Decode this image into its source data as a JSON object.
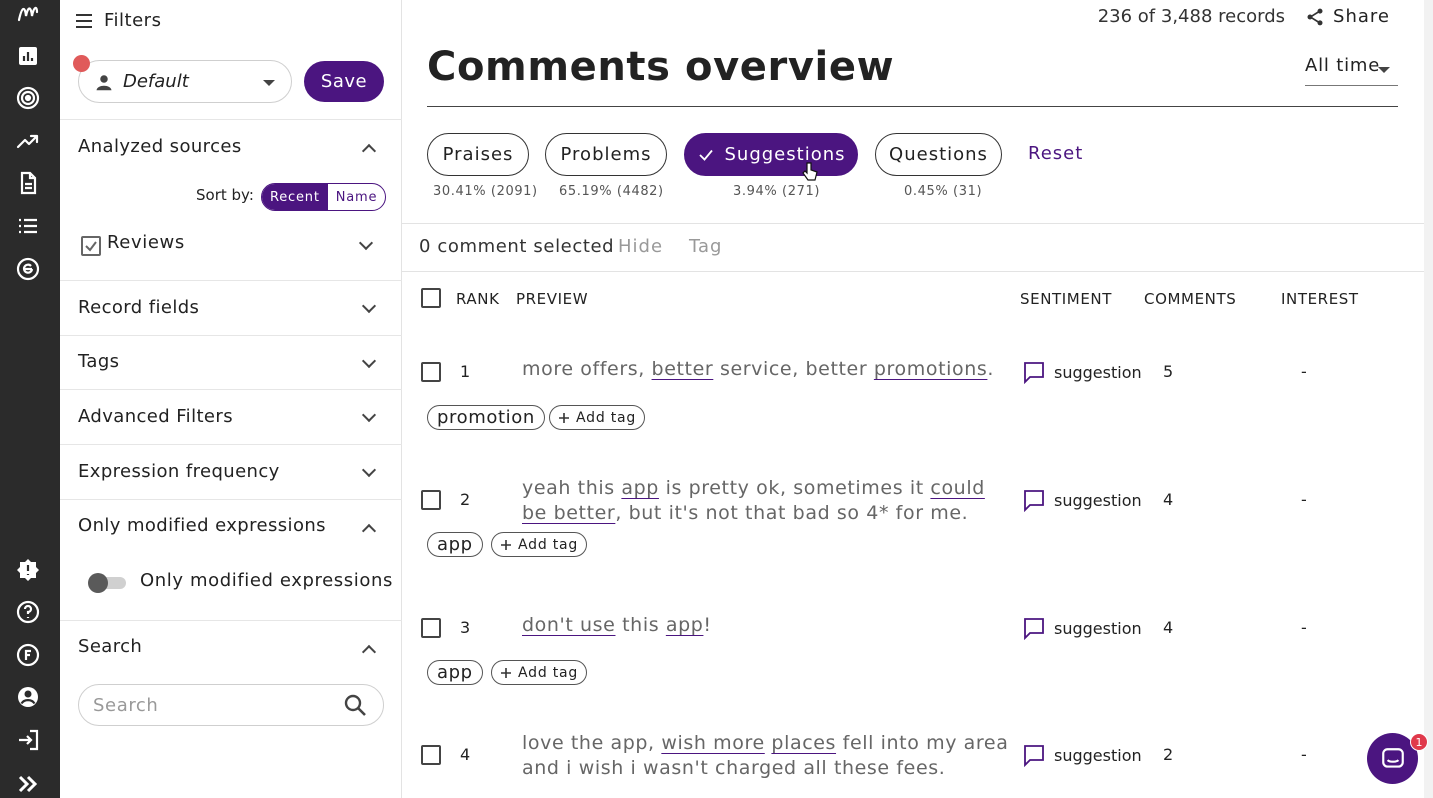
{
  "rail": {
    "icons": [
      "logo-icon",
      "dashboard-icon",
      "target-icon",
      "trend-icon",
      "document-icon",
      "list-icon",
      "explore-icon",
      "badge-icon",
      "help-icon",
      "forum-icon",
      "account-icon",
      "logout-icon",
      "expand-icon"
    ]
  },
  "filters": {
    "title": "Filters",
    "preset_value": "Default",
    "save_label": "Save",
    "sections": {
      "analyzed_sources": "Analyzed sources",
      "sort_by_label": "Sort by:",
      "sort_recent": "Recent",
      "sort_name": "Name",
      "reviews": "Reviews",
      "record_fields": "Record fields",
      "tags": "Tags",
      "advanced_filters": "Advanced Filters",
      "expression_frequency": "Expression frequency",
      "only_modified": "Only modified expressions",
      "only_modified_toggle_label": "Only modified expressions",
      "search": "Search",
      "search_placeholder": "Search"
    }
  },
  "header": {
    "records": "236 of 3,488 records",
    "share": "Share",
    "title": "Comments overview",
    "time_range": "All time"
  },
  "categories": [
    {
      "label": "Praises",
      "stat": "30.41% (2091)"
    },
    {
      "label": "Problems",
      "stat": "65.19% (4482)"
    },
    {
      "label": "Suggestions",
      "stat": "3.94% (271)"
    },
    {
      "label": "Questions",
      "stat": "0.45% (31)"
    }
  ],
  "reset_label": "Reset",
  "actions": {
    "selected": "0 comment selected",
    "hide": "Hide",
    "tag": "Tag"
  },
  "table": {
    "headers": {
      "rank": "RANK",
      "preview": "PREVIEW",
      "sentiment": "SENTIMENT",
      "comments": "COMMENTS",
      "interest": "INTEREST"
    },
    "add_tag": "Add tag",
    "rows": [
      {
        "rank": "1",
        "sentiment": "suggestion",
        "comments": "5",
        "interest": "-",
        "tag": "promotion"
      },
      {
        "rank": "2",
        "sentiment": "suggestion",
        "comments": "4",
        "interest": "-",
        "tag": "app"
      },
      {
        "rank": "3",
        "sentiment": "suggestion",
        "comments": "4",
        "interest": "-",
        "tag": "app"
      },
      {
        "rank": "4",
        "sentiment": "suggestion",
        "comments": "2",
        "interest": "-",
        "tag": ""
      }
    ],
    "previews": [
      [
        "more offers, ",
        "better",
        " service, better ",
        "promotions",
        "."
      ],
      [
        "yeah this ",
        "app",
        " is pretty ok, sometimes it ",
        "could be better",
        ", but it's not that bad so 4* for me."
      ],
      [
        "",
        "don't use",
        " this ",
        "app",
        "!"
      ],
      [
        "love the app, ",
        "wish more",
        " ",
        "places",
        " fell into my area and i wish i wasn't charged all these fees."
      ]
    ]
  },
  "chat_badge": "1"
}
